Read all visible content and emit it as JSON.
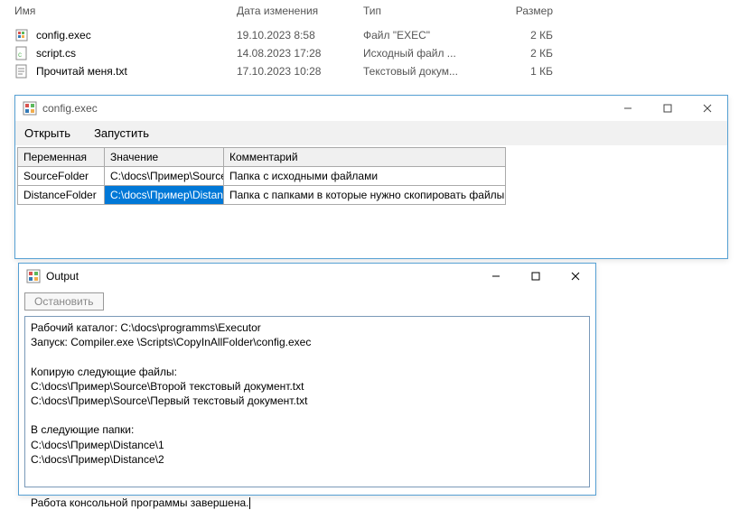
{
  "file_list": {
    "headers": {
      "name": "Имя",
      "date": "Дата изменения",
      "type": "Тип",
      "size": "Размер"
    },
    "rows": [
      {
        "icon": "exec",
        "name": "config.exec",
        "date": "19.10.2023 8:58",
        "type": "Файл \"EXEC\"",
        "size": "2 КБ"
      },
      {
        "icon": "cs",
        "name": "script.cs",
        "date": "14.08.2023 17:28",
        "type": "Исходный файл ...",
        "size": "2 КБ"
      },
      {
        "icon": "txt",
        "name": "Прочитай меня.txt",
        "date": "17.10.2023 10:28",
        "type": "Текстовый докум...",
        "size": "1 КБ"
      }
    ]
  },
  "config_window": {
    "title": "config.exec",
    "menu": {
      "open": "Открыть",
      "run": "Запустить"
    },
    "grid": {
      "headers": {
        "var": "Переменная",
        "val": "Значение",
        "com": "Комментарий"
      },
      "rows": [
        {
          "var": "SourceFolder",
          "val": "C:\\docs\\Пример\\Source",
          "com": "Папка с исходными файлами"
        },
        {
          "var": "DistanceFolder",
          "val": "C:\\docs\\Пример\\Distance",
          "com": "Папка с папками в которые нужно скопировать файлы"
        }
      ]
    }
  },
  "output_window": {
    "title": "Output",
    "stop_button": "Остановить",
    "lines": [
      "Рабочий каталог: C:\\docs\\programms\\Executor",
      "Запуск: Compiler.exe \\Scripts\\CopyInAllFolder\\config.exec",
      "",
      "Копирую следующие файлы:",
      "C:\\docs\\Пример\\Source\\Второй текстовый документ.txt",
      "C:\\docs\\Пример\\Source\\Первый текстовый документ.txt",
      "",
      "В следующие папки:",
      "C:\\docs\\Пример\\Distance\\1",
      "C:\\docs\\Пример\\Distance\\2",
      "",
      "",
      "Работа консольной программы завершена."
    ]
  }
}
